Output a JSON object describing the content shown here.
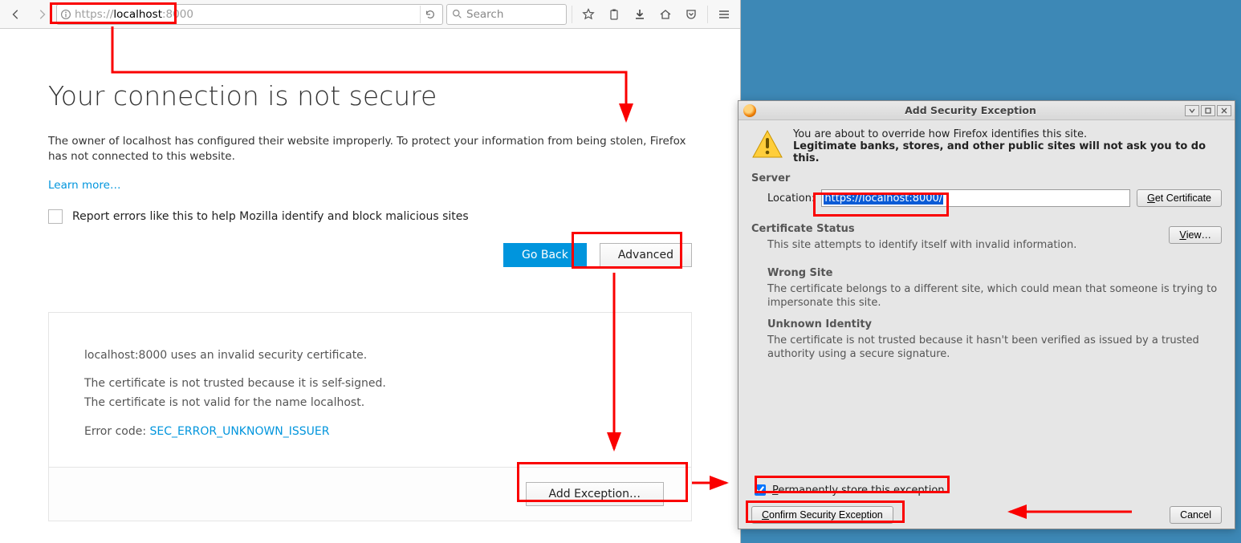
{
  "browser": {
    "url_proto": "https://",
    "url_host": "localhost",
    "url_port": ":8000",
    "search_placeholder": "Search"
  },
  "page": {
    "title": "Your connection is not secure",
    "body_line1": "The owner of localhost has configured their website improperly. To protect your information from being stolen, Firefox has not connected to this website.",
    "learn_more": "Learn more…",
    "report_label": "Report errors like this to help Mozilla identify and block malicious sites",
    "go_back": "Go Back",
    "advanced": "Advanced",
    "tech_l1": "localhost:8000 uses an invalid security certificate.",
    "tech_l2": "The certificate is not trusted because it is self-signed.",
    "tech_l3": "The certificate is not valid for the name localhost.",
    "error_code_label": "Error code: ",
    "error_code": "SEC_ERROR_UNKNOWN_ISSUER",
    "add_exception": "Add Exception…"
  },
  "dialog": {
    "title": "Add Security Exception",
    "warn_line1": "You are about to override how Firefox identifies this site.",
    "warn_line2": "Legitimate banks, stores, and other public sites will not ask you to do this.",
    "server_label": "Server",
    "location_label": "Location:",
    "location_value": "https://localhost:8000/",
    "get_cert": "Get Certificate",
    "cert_status": "Certificate Status",
    "cert_status_line": "This site attempts to identify itself with invalid information.",
    "view": "View…",
    "wrong_site": "Wrong Site",
    "wrong_site_text": "The certificate belongs to a different site, which could mean that someone is trying to impersonate this site.",
    "unknown_id": "Unknown Identity",
    "unknown_id_text": "The certificate is not trusted because it hasn't been verified as issued by a trusted authority using a secure signature.",
    "perm_label_pre": "P",
    "perm_label_rest": "ermanently store this exception",
    "confirm_pre": "C",
    "confirm_rest": "onfirm Security Exception",
    "cancel": "Cancel"
  }
}
